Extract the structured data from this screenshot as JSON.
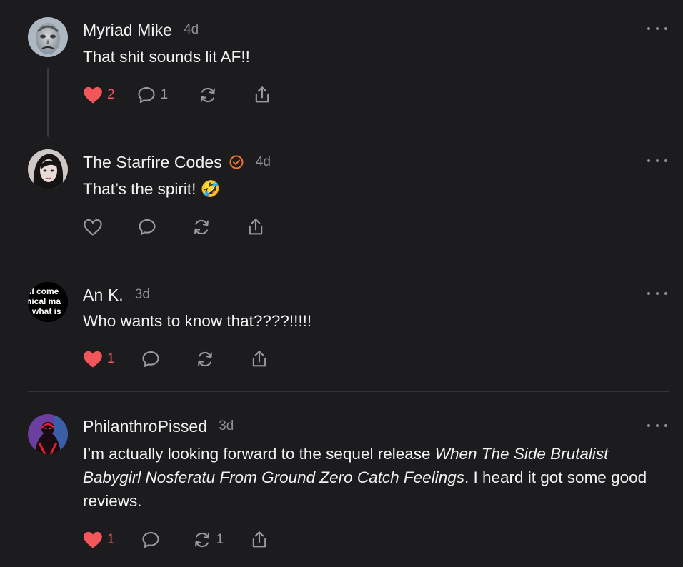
{
  "colors": {
    "background": "#1c1c1e",
    "text": "#f2f2f2",
    "muted": "#8e8e93",
    "like": "#f2555a",
    "verified": "#f0732f"
  },
  "posts": [
    {
      "username": "Myriad Mike",
      "time": "4d",
      "text": "That shit sounds lit AF!!",
      "liked": true,
      "like_count": "2",
      "comment_count": "1",
      "repost_count": "",
      "icons": [
        "heart-filled-icon",
        "comment-icon",
        "repost-icon",
        "share-icon",
        "more-icon"
      ]
    },
    {
      "username": "The Starfire Codes",
      "verified": true,
      "time": "4d",
      "text": "That’s the spirit! 🤣",
      "liked": false,
      "like_count": "",
      "comment_count": "",
      "repost_count": "",
      "icons": [
        "heart-outline-icon",
        "comment-icon",
        "repost-icon",
        "share-icon",
        "more-icon"
      ]
    },
    {
      "username": "An K.",
      "time": "3d",
      "text": "Who wants to know that????!!!!!",
      "avatar_text": [
        "ll come",
        "hical ma",
        "what is"
      ],
      "liked": true,
      "like_count": "1",
      "comment_count": "",
      "repost_count": "",
      "icons": [
        "heart-filled-icon",
        "comment-icon",
        "repost-icon",
        "share-icon",
        "more-icon"
      ]
    },
    {
      "username": "PhilanthroPissed",
      "time": "3d",
      "text_part1": "I’m actually looking forward to the sequel release ",
      "text_italic": "When The Side Brutalist Babygirl Nosferatu From Ground Zero Catch Feelings",
      "text_part2": ". I heard it got some good reviews.",
      "liked": true,
      "like_count": "1",
      "comment_count": "",
      "repost_count": "1",
      "icons": [
        "heart-filled-icon",
        "comment-icon",
        "repost-icon",
        "share-icon",
        "more-icon"
      ]
    }
  ]
}
